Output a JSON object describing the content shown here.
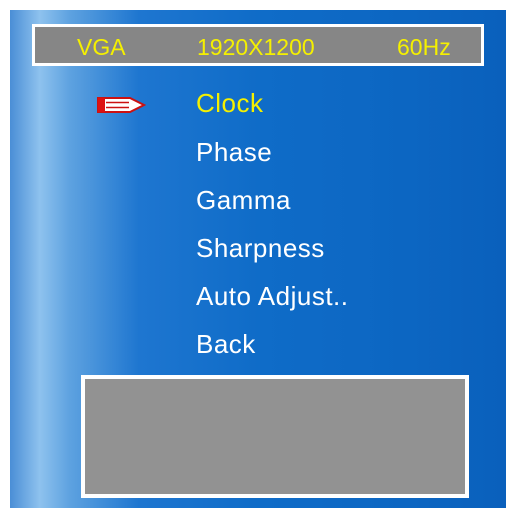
{
  "status": {
    "source": "VGA",
    "resolution": "1920X1200",
    "refresh_rate": "60Hz"
  },
  "menu": {
    "items": [
      {
        "label": "Clock",
        "selected": true
      },
      {
        "label": "Phase",
        "selected": false
      },
      {
        "label": "Gamma",
        "selected": false
      },
      {
        "label": "Sharpness",
        "selected": false
      },
      {
        "label": "Auto Adjust..",
        "selected": false
      },
      {
        "label": "Back",
        "selected": false
      }
    ]
  },
  "colors": {
    "highlight": "#f5f000",
    "text": "#ffffff",
    "panel": "#0f6cc8",
    "box": "#929292"
  },
  "icons": {
    "pointer": "pencil-pointer-icon"
  }
}
